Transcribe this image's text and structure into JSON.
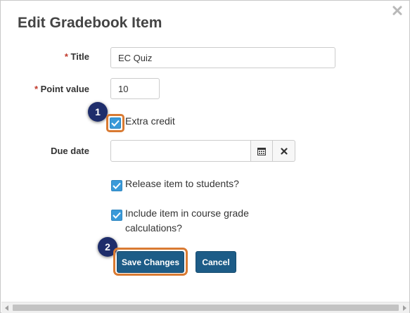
{
  "dialog": {
    "title": "Edit Gradebook Item",
    "close_icon": "close-icon"
  },
  "form": {
    "title": {
      "required_marker": "*",
      "label": "Title",
      "value": "EC Quiz"
    },
    "point_value": {
      "required_marker": "*",
      "label": "Point value",
      "value": "10"
    },
    "extra_credit": {
      "label": "Extra credit",
      "checked": true
    },
    "due_date": {
      "label": "Due date",
      "value": "",
      "placeholder": "",
      "calendar_icon": "calendar-icon",
      "clear_icon": "clear-x-icon"
    },
    "release": {
      "label": "Release item to students?",
      "checked": true
    },
    "include": {
      "label_line1": "Include item in course grade",
      "label_line2": "calculations?",
      "checked": true
    }
  },
  "buttons": {
    "save": "Save Changes",
    "cancel": "Cancel"
  },
  "callouts": {
    "first": "1",
    "second": "2"
  },
  "colors": {
    "primary_button": "#1d5c87",
    "checkbox": "#3a9ad9",
    "callout": "#1e2d6b",
    "highlight": "#d97a32"
  }
}
